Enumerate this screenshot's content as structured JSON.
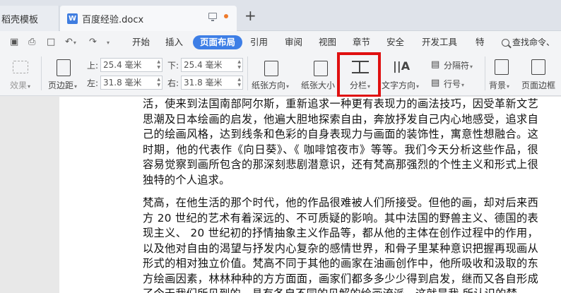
{
  "tabs": {
    "template": "稻壳模板",
    "document": "百度经验.docx",
    "new_tab": "+"
  },
  "menu": {
    "items": [
      "开始",
      "插入",
      "页面布局",
      "引用",
      "审阅",
      "视图",
      "章节",
      "安全",
      "开发工具",
      "特"
    ],
    "active": "页面布局",
    "search": "查找命令、"
  },
  "toolbar": {
    "effects": "效果",
    "margins": "页边距",
    "top_label": "上:",
    "top_value": "25.4 毫米",
    "bottom_label": "下:",
    "bottom_value": "25.4 毫米",
    "left_label": "左:",
    "left_value": "31.8 毫米",
    "right_label": "右:",
    "right_value": "31.8 毫米",
    "orientation": "纸张方向",
    "size": "纸张大小",
    "columns": "分栏",
    "text_direction": "文字方向",
    "separator": "分隔符",
    "line_number": "行号",
    "background": "背景",
    "page_border": "页面边框",
    "highlight_color": "#e01010",
    "accent_color": "#3d7ee6"
  },
  "document": {
    "paragraph1": "活，使来到法国南部阿尔斯，重新追求一种更有表现力的画法技巧，因受革新文艺思潮及日本绘画的启发，他遍大胆地探索自由，奔放抒发自己内心地感受，追求自己的绘画风格，达到线条和色彩的自身表现力与画面的装饰性，寓意性想融合。这时期，他的代表作《向日葵》、《 咖啡馆夜市》等等。我们今天分析这些作品，很容易觉察到画所包含的那深刻悲剧潜意识，还有梵高那强烈的个性主义和形式上很独特的个人追求。",
    "paragraph2": "梵高，在他生活的那个时代，他的作品很难被人们所接受。但他的画，却对后来西方 20 世纪的艺术有着深远的、不可质疑的影响。其中法国的野兽主义、德国的表现主义、 20 世纪初的抒情抽象主义作品等，都从他的主体在创作过程中的作用，以及他对自由的渴望与抒发内心复杂的感情世界，和骨子里某种意识把握再现画从形式的相对独立价值。梵高不同于其他的画家在油画创作中，他所吸收和汲取的东方绘画因素，林林种种的方方面面，画家们都多多少少得到启发，继而又各自形成了今天我们所见到的，具有各自不同的见解的绘画流派。这就是我 所认识的梵"
  }
}
